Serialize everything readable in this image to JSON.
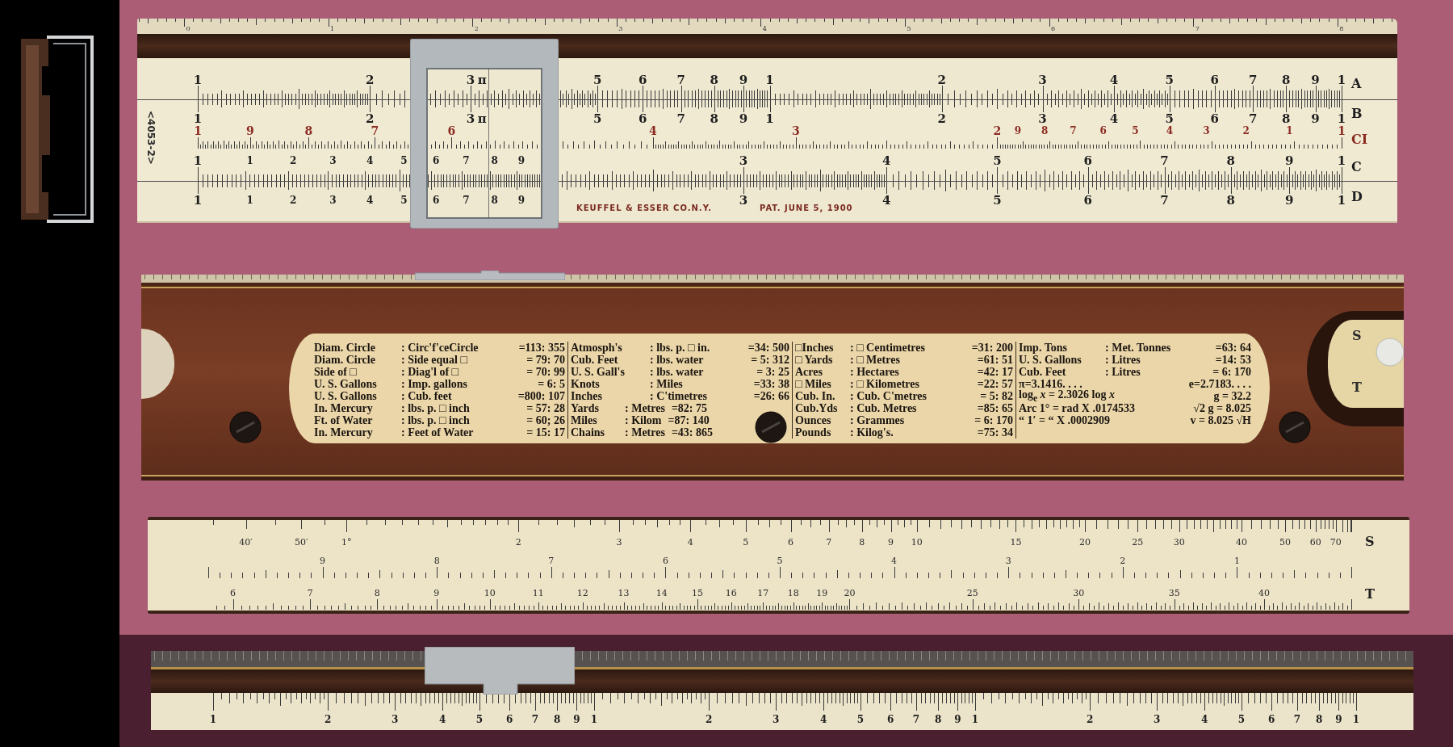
{
  "front_view": {
    "edge_scale": {
      "labels": [
        "0",
        "1",
        "2",
        "3",
        "4",
        "5",
        "6",
        "7",
        "8"
      ]
    },
    "serial": "<4053-2>",
    "scales": [
      {
        "letter": "A",
        "labels": [
          "1",
          "2",
          "3",
          "π",
          "5",
          "6",
          "7",
          "8",
          "9",
          "1",
          "2",
          "3",
          "4",
          "5",
          "6",
          "7",
          "8",
          "9",
          "1"
        ]
      },
      {
        "letter": "B",
        "labels": [
          "1",
          "2",
          "3",
          "π",
          "5",
          "6",
          "7",
          "8",
          "9",
          "1",
          "2",
          "3",
          "4",
          "5",
          "6",
          "7",
          "8",
          "9",
          "1"
        ]
      },
      {
        "letter": "CI",
        "labels": [
          "1",
          "9",
          "8",
          "7",
          "6",
          "4",
          "3",
          "2",
          "9",
          "8",
          "7",
          "6",
          "5",
          "4",
          "3",
          "2",
          "1",
          "1"
        ]
      },
      {
        "letter": "C",
        "labels": [
          "1",
          "1",
          "2",
          "3",
          "4",
          "5",
          "6",
          "7",
          "8",
          "9",
          "3",
          "4",
          "5",
          "6",
          "7",
          "8",
          "9",
          "1"
        ]
      },
      {
        "letter": "D",
        "labels": [
          "1",
          "1",
          "2",
          "3",
          "4",
          "5",
          "6",
          "7",
          "8",
          "9",
          "3",
          "4",
          "5",
          "6",
          "7",
          "8",
          "9",
          "1"
        ]
      }
    ],
    "maker": "KEUFFEL & ESSER CO.N.Y.",
    "patent": "PAT. JUNE 5, 1900"
  },
  "back_view": {
    "window_letters": [
      "S",
      "T"
    ],
    "table": {
      "sections": [
        {
          "rows": [
            {
              "kind": "conversion",
              "unit": "Diam. Circle",
              "equivalent": ": Circ'f'ceCircle",
              "ratio": "=113: 355"
            },
            {
              "kind": "conversion",
              "unit": "Diam. Circle",
              "equivalent": ": Side equal □",
              "ratio": "= 79: 70"
            },
            {
              "kind": "conversion",
              "unit": "Side of □",
              "equivalent": ": Diag'l of □",
              "ratio": "= 70: 99"
            },
            {
              "kind": "conversion",
              "unit": "U. S. Gallons",
              "equivalent": ": Imp. gallons",
              "ratio": "= 6: 5"
            },
            {
              "kind": "conversion",
              "unit": "U. S. Gallons",
              "equivalent": ": Cub. feet",
              "ratio": "=800: 107"
            },
            {
              "kind": "conversion",
              "unit": "In. Mercury",
              "equivalent": ": lbs. p. □ inch",
              "ratio": "= 57: 28"
            },
            {
              "kind": "conversion",
              "unit": "Ft. of Water",
              "equivalent": ": lbs. p. □ inch",
              "ratio": "= 60; 26"
            },
            {
              "kind": "conversion",
              "unit": "In. Mercury",
              "equivalent": ": Feet of Water",
              "ratio": "= 15: 17"
            }
          ]
        },
        {
          "rows": [
            {
              "kind": "conversion",
              "unit": "Atmosph's",
              "equivalent": ": lbs. p. □ in.",
              "ratio": "=34: 500"
            },
            {
              "kind": "conversion",
              "unit": "Cub. Feet",
              "equivalent": ": lbs. water",
              "ratio": "= 5: 312"
            },
            {
              "kind": "conversion",
              "unit": "U. S. Gall's",
              "equivalent": ": lbs. water",
              "ratio": "= 3: 25"
            },
            {
              "kind": "conversion",
              "unit": "Knots",
              "equivalent": ": Miles",
              "ratio": "=33: 38"
            },
            {
              "kind": "conversion",
              "unit": "Inches",
              "equivalent": ": C'timetres",
              "ratio": "=26: 66"
            },
            {
              "kind": "conversion",
              "unit": "Yards",
              "equivalent": ": Metres",
              "ratio": "=82: 75"
            },
            {
              "kind": "conversion",
              "unit": "Miles",
              "equivalent": ": Kilom",
              "ratio": "=87: 140"
            },
            {
              "kind": "conversion",
              "unit": "Chains",
              "equivalent": ": Metres",
              "ratio": "=43: 865"
            }
          ]
        },
        {
          "rows": [
            {
              "kind": "conversion",
              "unit": "□Inches",
              "equivalent": ": □ Centimetres",
              "ratio": "=31: 200"
            },
            {
              "kind": "conversion",
              "unit": "□ Yards",
              "equivalent": ": □ Metres",
              "ratio": "=61: 51"
            },
            {
              "kind": "conversion",
              "unit": "Acres",
              "equivalent": ": Hectares",
              "ratio": "=42: 17"
            },
            {
              "kind": "conversion",
              "unit": "□ Miles",
              "equivalent": ": □ Kilometres",
              "ratio": "=22: 57"
            },
            {
              "kind": "conversion",
              "unit": "Cub. In.",
              "equivalent": ": Cub. C'metres",
              "ratio": "= 5: 82"
            },
            {
              "kind": "conversion",
              "unit": "Cub.Yds",
              "equivalent": ": Cub. Metres",
              "ratio": "=85: 65"
            },
            {
              "kind": "conversion",
              "unit": "Ounces",
              "equivalent": ": Grammes",
              "ratio": "= 6: 170"
            },
            {
              "kind": "conversion",
              "unit": "Pounds",
              "equivalent": ": Kilog's.",
              "ratio": "=75: 34"
            }
          ]
        },
        {
          "rows": [
            {
              "kind": "conversion",
              "unit": "Imp. Tons",
              "equivalent": ": Met. Tonnes",
              "ratio": "=63: 64"
            },
            {
              "kind": "conversion",
              "unit": "U. S. Gallons",
              "equivalent": ": Litres",
              "ratio": "=14: 53"
            },
            {
              "kind": "conversion",
              "unit": "Cub. Feet",
              "equivalent": ": Litres",
              "ratio": "= 6: 170"
            },
            {
              "kind": "formula",
              "left": "π=3.1416. . . .",
              "right": "e=2.7183. . . ."
            },
            {
              "kind": "formula",
              "left": "log$_{e}$ *x* = 2.3026 log *x*",
              "right": "g = 32.2"
            },
            {
              "kind": "formula",
              "left": "Arc 1° = rad X .0174533",
              "right": "√2 g = 8.025"
            },
            {
              "kind": "formula",
              "left": "“ 1′ = “ X .0002909",
              "right": "v = 8.025 √H"
            }
          ]
        }
      ]
    }
  },
  "slide_reverse": {
    "scales": [
      {
        "letter": "S",
        "labels": [
          "40′",
          "50′",
          "1°",
          "2",
          "3",
          "4",
          "5",
          "6",
          "7",
          "8",
          "9",
          "10",
          "15",
          "20",
          "25",
          "30",
          "40",
          "50",
          "60",
          "70"
        ]
      },
      {
        "labels": [
          "9",
          "8",
          "7",
          "6",
          "5",
          "4",
          "3",
          "2",
          "1"
        ]
      },
      {
        "letter": "T",
        "labels": [
          "6",
          "7",
          "8",
          "9",
          "10",
          "11",
          "12",
          "13",
          "14",
          "15",
          "16",
          "17",
          "18",
          "19",
          "20",
          "25",
          "30",
          "35",
          "40"
        ]
      }
    ]
  },
  "edge_view": {
    "labels": [
      "1",
      "2",
      "3",
      "4",
      "5",
      "6",
      "7",
      "8",
      "9",
      "1",
      "2",
      "3",
      "4",
      "5",
      "6",
      "7",
      "8",
      "9",
      "1",
      "2",
      "3",
      "4",
      "5",
      "6",
      "7",
      "8",
      "9",
      "1"
    ]
  }
}
